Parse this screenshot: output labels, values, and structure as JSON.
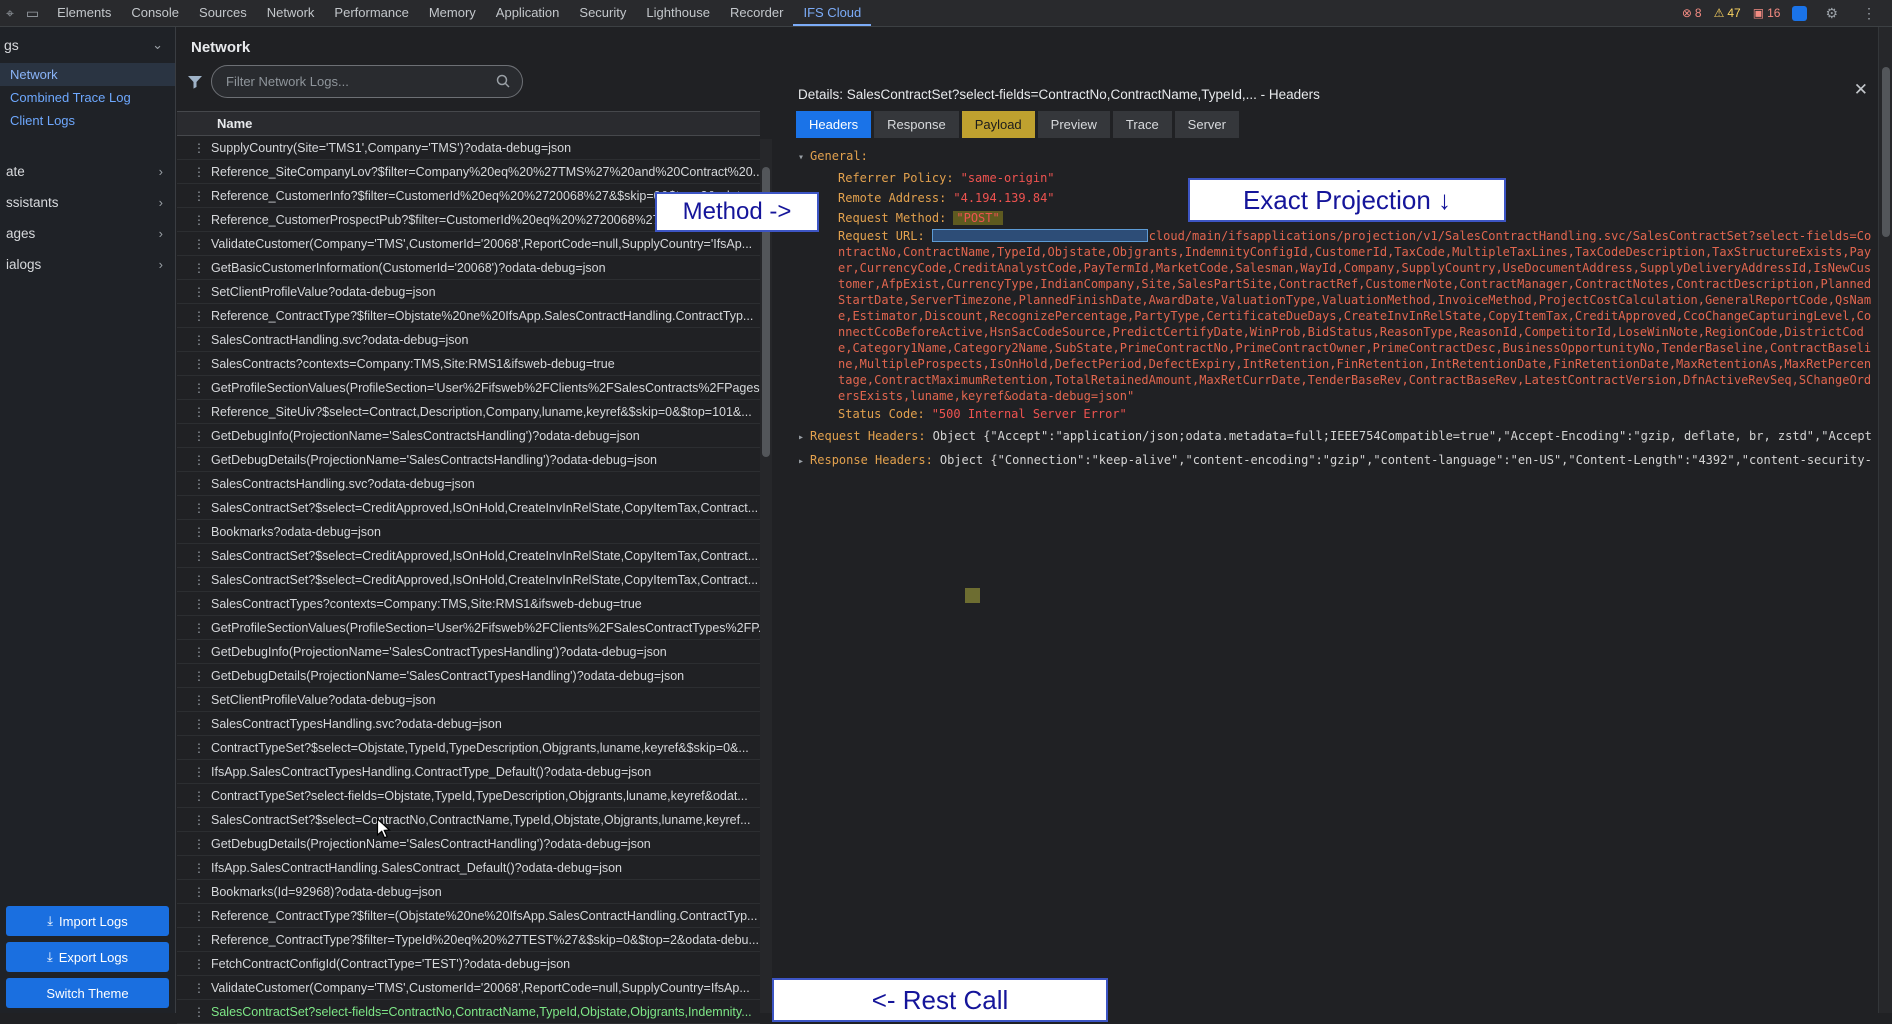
{
  "colors": {
    "accent_blue": "#1a73e8",
    "payload_tab_yellow": "#bfa12f",
    "error_red": "#f28b82",
    "warning_yellow": "#fdd663",
    "row_highlight_green": "#7ee787",
    "annotation_ink_navy": "#15159a",
    "annotation_border_blue": "#3d55c4",
    "label_orange": "#e2a14e",
    "value_red": "#ef5350"
  },
  "icons": {
    "close": "✕",
    "gear": "⚙",
    "kebab": "⋮",
    "error": "⊗",
    "warning": "⚠",
    "issues": "▣",
    "chevron_down": "⌄",
    "chevron_right": "›",
    "expanded": "▾",
    "collapsed": "▸",
    "inspect": "⌖",
    "device": "▭"
  },
  "devtools": {
    "tabs": [
      {
        "label": "Elements"
      },
      {
        "label": "Console"
      },
      {
        "label": "Sources"
      },
      {
        "label": "Network"
      },
      {
        "label": "Performance"
      },
      {
        "label": "Memory"
      },
      {
        "label": "Application"
      },
      {
        "label": "Security"
      },
      {
        "label": "Lighthouse"
      },
      {
        "label": "Recorder"
      },
      {
        "label": "IFS Cloud",
        "cls": "active"
      }
    ],
    "error_count": "8",
    "warning_count": "47",
    "issue_count": "16"
  },
  "sidebar": {
    "section_title": "gs",
    "links": [
      {
        "label": "Network",
        "cls": "selected"
      },
      {
        "label": "Combined Trace Log"
      },
      {
        "label": "Client Logs"
      }
    ],
    "groups": [
      {
        "label": "ate"
      },
      {
        "label": "ssistants"
      },
      {
        "label": "ages"
      },
      {
        "label": "ialogs"
      }
    ],
    "buttons": [
      {
        "label": "Import Logs",
        "icon": "⤓"
      },
      {
        "label": "Export Logs",
        "icon": "⤓"
      },
      {
        "label": "Switch Theme",
        "icon": ""
      }
    ]
  },
  "network_panel": {
    "title": "Network",
    "filter_placeholder": "Filter Network Logs...",
    "column_header": "Name",
    "highlighted_row_index": 36,
    "rows": [
      "SupplyCountry(Site='TMS1',Company='TMS')?odata-debug=json",
      "Reference_SiteCompanyLov?$filter=Company%20eq%20%27TMS%27%20and%20Contract%20...",
      "Reference_CustomerInfo?$filter=CustomerId%20eq%20%2720068%27&$skip=0&$top=2&odat...",
      "Reference_CustomerProspectPub?$filter=CustomerId%20eq%20%2720068%27&$skip=0&...",
      "ValidateCustomer(Company='TMS',CustomerId='20068',ReportCode=null,SupplyCountry='IfsAp...",
      "GetBasicCustomerInformation(CustomerId='20068')?odata-debug=json",
      "SetClientProfileValue?odata-debug=json",
      "Reference_ContractType?$filter=Objstate%20ne%20IfsApp.SalesContractHandling.ContractTyp...",
      "SalesContractHandling.svc?odata-debug=json",
      "SalesContracts?contexts=Company:TMS,Site:RMS1&ifsweb-debug=true",
      "GetProfileSectionValues(ProfileSection='User%2Fifsweb%2FClients%2FSalesContracts%2FPages...",
      "Reference_SiteUiv?$select=Contract,Description,Company,luname,keyref&$skip=0&$top=101&...",
      "GetDebugInfo(ProjectionName='SalesContractsHandling')?odata-debug=json",
      "GetDebugDetails(ProjectionName='SalesContractsHandling')?odata-debug=json",
      "SalesContractsHandling.svc?odata-debug=json",
      "SalesContractSet?$select=CreditApproved,IsOnHold,CreateInvInRelState,CopyItemTax,Contract...",
      "Bookmarks?odata-debug=json",
      "SalesContractSet?$select=CreditApproved,IsOnHold,CreateInvInRelState,CopyItemTax,Contract...",
      "SalesContractSet?$select=CreditApproved,IsOnHold,CreateInvInRelState,CopyItemTax,Contract...",
      "SalesContractTypes?contexts=Company:TMS,Site:RMS1&ifsweb-debug=true",
      "GetProfileSectionValues(ProfileSection='User%2Fifsweb%2FClients%2FSalesContractTypes%2FP...",
      "GetDebugInfo(ProjectionName='SalesContractTypesHandling')?odata-debug=json",
      "GetDebugDetails(ProjectionName='SalesContractTypesHandling')?odata-debug=json",
      "SetClientProfileValue?odata-debug=json",
      "SalesContractTypesHandling.svc?odata-debug=json",
      "ContractTypeSet?$select=Objstate,TypeId,TypeDescription,Objgrants,luname,keyref&$skip=0&...",
      "IfsApp.SalesContractTypesHandling.ContractType_Default()?odata-debug=json",
      "ContractTypeSet?select-fields=Objstate,TypeId,TypeDescription,Objgrants,luname,keyref&odat...",
      "SalesContractSet?$select=ContractNo,ContractName,TypeId,Objstate,Objgrants,luname,keyref...",
      "GetDebugDetails(ProjectionName='SalesContractHandling')?odata-debug=json",
      "IfsApp.SalesContractHandling.SalesContract_Default()?odata-debug=json",
      "Bookmarks(Id=92968)?odata-debug=json",
      "Reference_ContractType?$filter=(Objstate%20ne%20IfsApp.SalesContractHandling.ContractTyp...",
      "Reference_ContractType?$filter=TypeId%20eq%20%27TEST%27&$skip=0&$top=2&odata-debu...",
      "FetchContractConfigId(ContractType='TEST')?odata-debug=json",
      "ValidateCustomer(Company='TMS',CustomerId='20068',ReportCode=null,SupplyCountry=IfsAp...",
      "SalesContractSet?select-fields=ContractNo,ContractName,TypeId,Objstate,Objgrants,Indemnity..."
    ]
  },
  "details": {
    "title": "Details: SalesContractSet?select-fields=ContractNo,ContractName,TypeId,... - Headers",
    "tabs": [
      {
        "label": "Headers",
        "cls": "tab-active"
      },
      {
        "label": "Response"
      },
      {
        "label": "Payload",
        "cls": "tab-payload"
      },
      {
        "label": "Preview"
      },
      {
        "label": "Trace"
      },
      {
        "label": "Server"
      }
    ],
    "general_label": "General:",
    "fields": {
      "referrer_policy_label": "Referrer Policy:",
      "referrer_policy_value": "\"same-origin\"",
      "remote_address_label": "Remote Address:",
      "remote_address_value": "\"4.194.139.84\"",
      "request_method_label": "Request Method:",
      "request_method_value": "\"POST\"",
      "request_url_label": "Request URL:",
      "request_url_value": "cloud/main/ifsapplications/projection/v1/SalesContractHandling.svc/SalesContractSet?select-fields=ContractNo,ContractName,TypeId,Objstate,Objgrants,IndemnityConfigId,CustomerId,TaxCode,MultipleTaxLines,TaxCodeDescription,TaxStructureExists,Payer,CurrencyCode,CreditAnalystCode,PayTermId,MarketCode,Salesman,WayId,Company,SupplyCountry,UseDocumentAddress,SupplyDeliveryAddressId,IsNewCustomer,AfpExist,CurrencyType,IndianCompany,Site,SalesPartSite,ContractRef,CustomerNote,ContractManager,ContractNotes,ContractDescription,PlannedStartDate,ServerTimezone,PlannedFinishDate,AwardDate,ValuationType,ValuationMethod,InvoiceMethod,ProjectCostCalculation,GeneralReportCode,QsName,Estimator,Discount,RecognizePercentage,PartyType,CertificateDueDays,CreateInvInRelState,CopyItemTax,CreditApproved,CcoChangeCapturingLevel,ConnectCcoBeforeActive,HsnSacCodeSource,PredictCertifyDate,WinProb,BidStatus,ReasonType,ReasonId,CompetitorId,LoseWinNote,RegionCode,DistrictCode,Category1Name,Category2Name,SubState,PrimeContractNo,PrimeContractOwner,PrimeContractDesc,BusinessOpportunityNo,TenderBaseline,ContractBaseline,MultipleProspects,IsOnHold,DefectPeriod,DefectExpiry,IntRetention,FinRetention,IntRetentionDate,FinRetentionDate,MaxRetentionAs,MaxRetPercentage,ContractMaximumRetention,TotalRetainedAmount,MaxRetCurrDate,TenderBaseRev,ContractBaseRev,LatestContractVersion,DfnActiveRevSeq,SChangeOrdersExists,luname,keyref&odata-debug=json\"",
      "status_code_label": "Status Code:",
      "status_code_value": "\"500 Internal Server Error\""
    },
    "request_headers_label": "Request Headers:",
    "request_headers_value": "Object {\"Accept\":\"application/json;odata.metadata=full;IEEE754Compatible=true\",\"Accept-Encoding\":\"gzip, deflate, br, zstd\",\"Accept-Language\":\"e",
    "response_headers_label": "Response Headers:",
    "response_headers_value": "Object {\"Connection\":\"keep-alive\",\"content-encoding\":\"gzip\",\"content-language\":\"en-US\",\"Content-Length\":\"4392\",\"content-security-policy\":\"defa"
  },
  "annotations": {
    "method": "Method ->",
    "projection": "Exact Projection ↓",
    "rest_call": "<- Rest Call"
  }
}
